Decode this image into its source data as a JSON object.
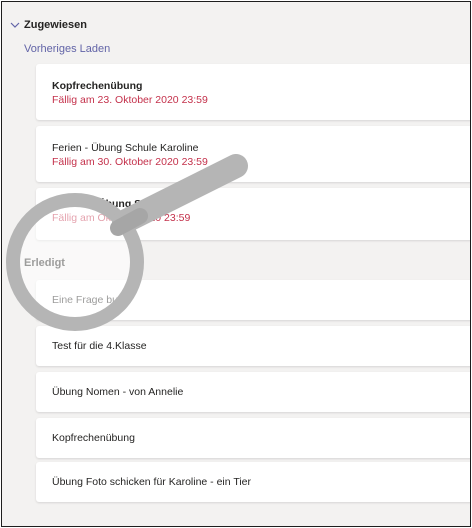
{
  "assigned": {
    "header": "Zugewiesen",
    "load_previous": "Vorheriges Laden",
    "items": [
      {
        "title": "Kopfrechenübung",
        "due": "Fällig am 23. Oktober 2020 23:59"
      },
      {
        "title": "Ferien - Übung Schule Karoline",
        "due": "Fällig am 30. Oktober 2020 23:59"
      },
      {
        "title": "Übung Schule",
        "due": "Fällig am Oktober 2020 23:59"
      }
    ]
  },
  "done": {
    "header": "Erledigt",
    "items": [
      {
        "title": "Eine Frage buch"
      },
      {
        "title": "Test für die 4.Klasse"
      },
      {
        "title": "Übung Nomen - von Annelie"
      },
      {
        "title": "Kopfrechenübung"
      },
      {
        "title": "Übung Foto schicken für Karoline - ein Tier"
      }
    ]
  },
  "colors": {
    "accent": "#6264a7",
    "due": "#c4314b",
    "background": "#f3f2f1",
    "card": "#ffffff"
  },
  "icons": {
    "section_toggle": "chevron-down-icon",
    "overlay": "magnifier-icon"
  }
}
